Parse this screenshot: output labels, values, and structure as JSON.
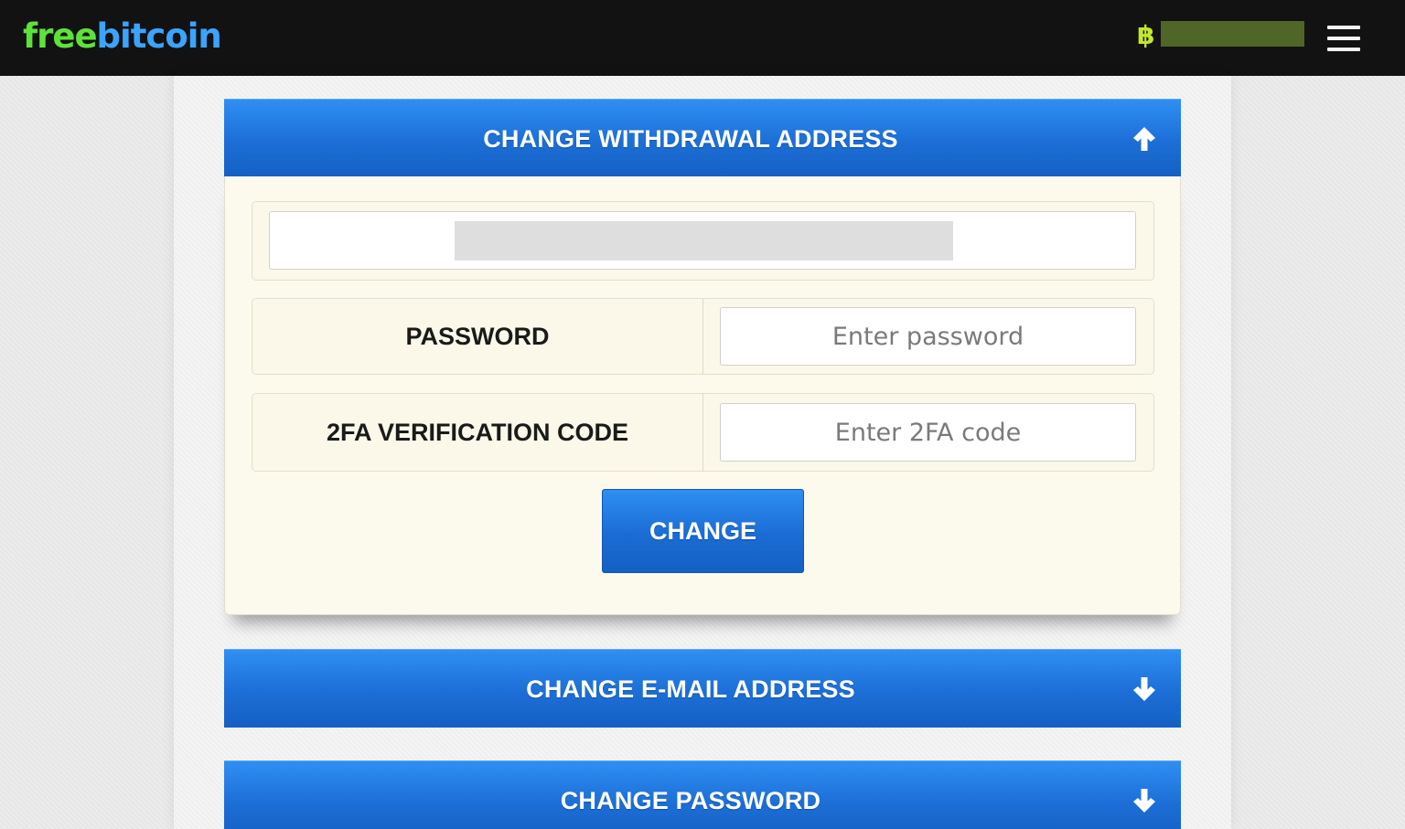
{
  "header": {
    "logo_part1": "free",
    "logo_part2": "bitcoin",
    "currency_symbol": "฿",
    "menu_icon": "hamburger-menu-icon"
  },
  "sections": [
    {
      "title": "CHANGE WITHDRAWAL ADDRESS",
      "expanded": true,
      "toggle_icon": "arrow-up-icon",
      "form": {
        "password_label": "PASSWORD",
        "password_placeholder": "Enter password",
        "twofa_label": "2FA VERIFICATION CODE",
        "twofa_placeholder": "Enter 2FA code",
        "submit_label": "CHANGE"
      }
    },
    {
      "title": "CHANGE E-MAIL ADDRESS",
      "expanded": false,
      "toggle_icon": "arrow-down-icon"
    },
    {
      "title": "CHANGE PASSWORD",
      "expanded": false,
      "toggle_icon": "arrow-down-icon"
    }
  ],
  "colors": {
    "topbar": "#121212",
    "logo_free": "#5de23a",
    "logo_bitcoin": "#3aa4ff",
    "accent_blue": "#1c6ed6",
    "panel_bg": "#fcfaec"
  }
}
